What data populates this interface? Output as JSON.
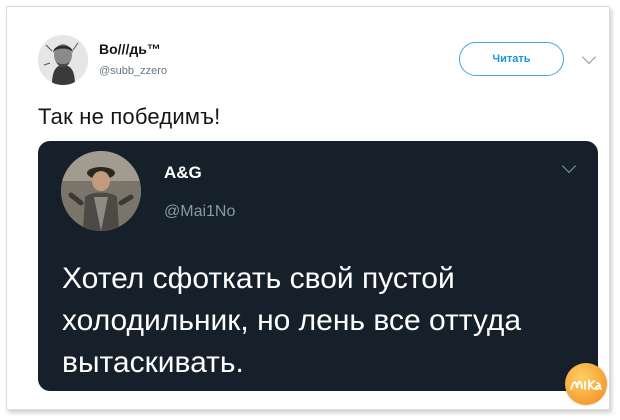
{
  "tweet": {
    "author_name": "Во///дь™",
    "author_handle": "@subb_zzero",
    "follow_label": "Читать",
    "text": "Так не победимъ!"
  },
  "quoted_tweet": {
    "author_name": "A&G",
    "author_handle": "@Mai1No",
    "text": "Хотел сфоткать свой пустой холодильник, но лень все оттуда вытаскивать."
  },
  "watermark": {
    "text": "Ника"
  },
  "colors": {
    "follow_accent": "#1b95e0",
    "quote_background": "#15202b",
    "handle_gray": "#657786"
  },
  "icons": [
    "chevron-down-icon",
    "avatar-engraving",
    "avatar-photo",
    "watermark-logo"
  ]
}
